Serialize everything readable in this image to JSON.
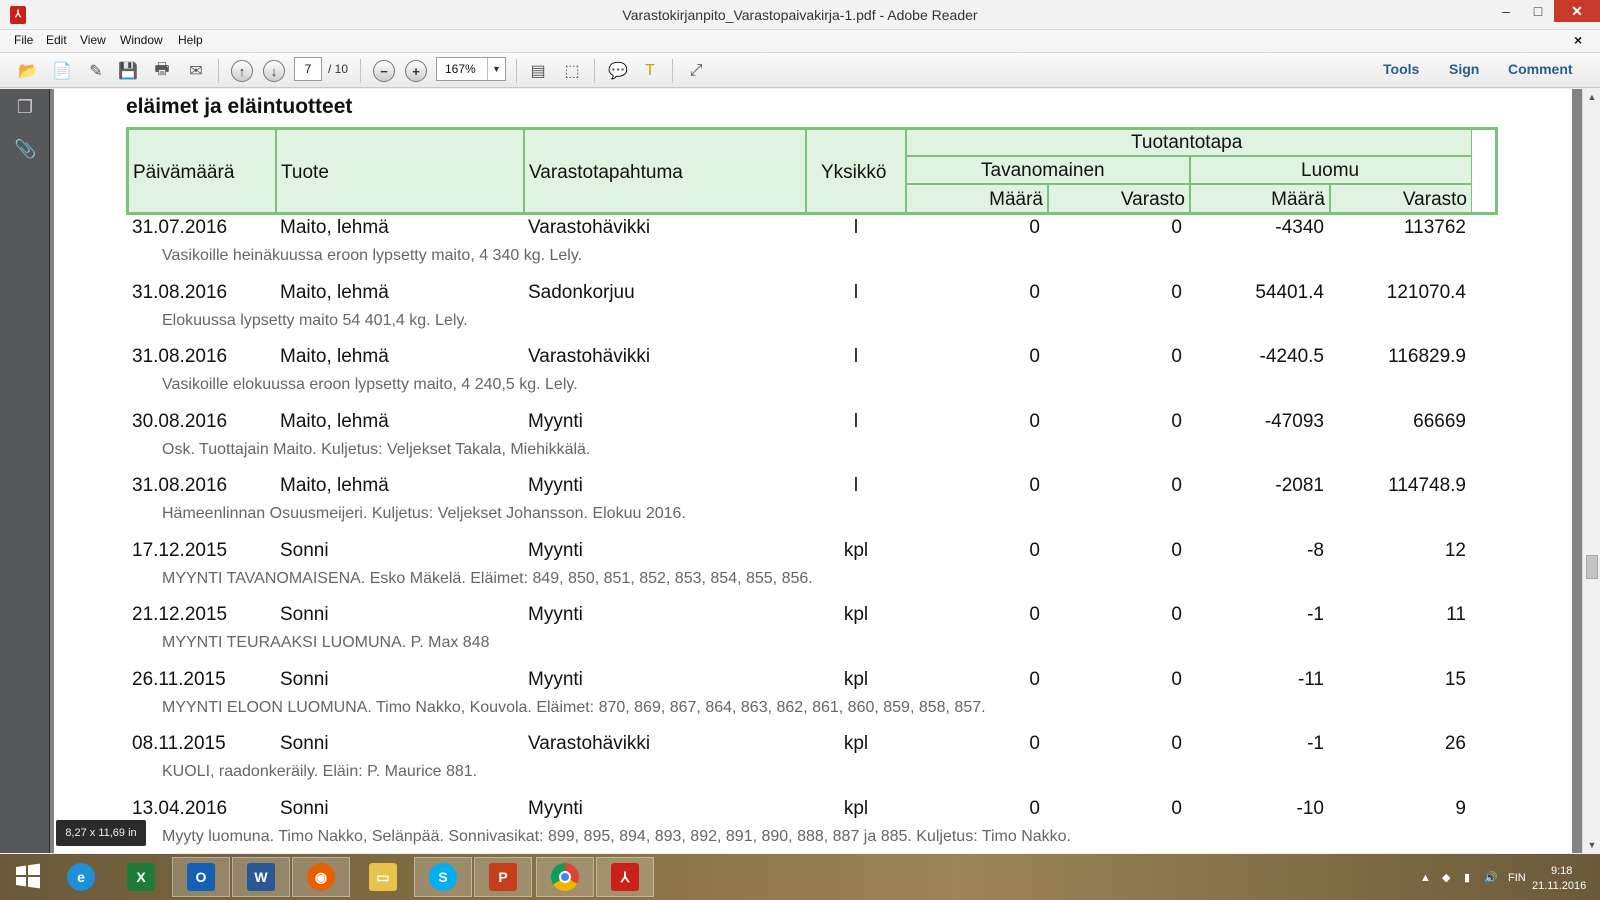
{
  "window": {
    "title": "Varastokirjanpito_Varastopaivakirja-1.pdf - Adobe Reader",
    "app_icon": "adobe-reader-icon",
    "controls": {
      "minimize": "–",
      "maximize": "□",
      "close": "✕"
    }
  },
  "menu": {
    "items": [
      "File",
      "Edit",
      "View",
      "Window",
      "Help"
    ],
    "close_doc": "×"
  },
  "toolbar": {
    "page_current": "7",
    "page_total": "/ 10",
    "zoom": "167%",
    "right_links": [
      "Tools",
      "Sign",
      "Comment"
    ]
  },
  "document": {
    "section_heading": "eläimet ja eläintuotteet",
    "table_header": {
      "date": "Päivämäärä",
      "product": "Tuote",
      "event": "Varastotapahtuma",
      "unit": "Yksikkö",
      "production_method": "Tuotantotapa",
      "conventional": "Tavanomainen",
      "organic": "Luomu",
      "conv_amount": "Määrä",
      "conv_stock": "Varasto",
      "org_amount": "Määrä",
      "org_stock": "Varasto"
    },
    "rows": [
      {
        "date": "31.07.2016",
        "product": "Maito, lehmä",
        "event": "Varastohävikki",
        "unit": "l",
        "conv_amount": "0",
        "conv_stock": "0",
        "org_amount": "-4340",
        "org_stock": "113762",
        "note": "Vasikoille heinäkuussa eroon lypsetty maito, 4 340 kg. Lely."
      },
      {
        "date": "31.08.2016",
        "product": "Maito, lehmä",
        "event": "Sadonkorjuu",
        "unit": "l",
        "conv_amount": "0",
        "conv_stock": "0",
        "org_amount": "54401.4",
        "org_stock": "121070.4",
        "note": "Elokuussa lypsetty maito 54 401,4 kg. Lely."
      },
      {
        "date": "31.08.2016",
        "product": "Maito, lehmä",
        "event": "Varastohävikki",
        "unit": "l",
        "conv_amount": "0",
        "conv_stock": "0",
        "org_amount": "-4240.5",
        "org_stock": "116829.9",
        "note": "Vasikoille elokuussa eroon lypsetty maito, 4 240,5 kg. Lely."
      },
      {
        "date": "30.08.2016",
        "product": "Maito, lehmä",
        "event": "Myynti",
        "unit": "l",
        "conv_amount": "0",
        "conv_stock": "0",
        "org_amount": "-47093",
        "org_stock": "66669",
        "note": "Osk. Tuottajain Maito. Kuljetus: Veljekset Takala, Miehikkälä."
      },
      {
        "date": "31.08.2016",
        "product": "Maito, lehmä",
        "event": "Myynti",
        "unit": "l",
        "conv_amount": "0",
        "conv_stock": "0",
        "org_amount": "-2081",
        "org_stock": "114748.9",
        "note": "Hämeenlinnan Osuusmeijeri. Kuljetus: Veljekset Johansson. Elokuu 2016."
      },
      {
        "date": "17.12.2015",
        "product": "Sonni",
        "event": "Myynti",
        "unit": "kpl",
        "conv_amount": "0",
        "conv_stock": "0",
        "org_amount": "-8",
        "org_stock": "12",
        "note": "MYYNTI TAVANOMAISENA. Esko Mäkelä. Eläimet: 849, 850, 851, 852, 853, 854, 855, 856."
      },
      {
        "date": "21.12.2015",
        "product": "Sonni",
        "event": "Myynti",
        "unit": "kpl",
        "conv_amount": "0",
        "conv_stock": "0",
        "org_amount": "-1",
        "org_stock": "11",
        "note": "MYYNTI TEURAAKSI LUOMUNA. P. Max 848"
      },
      {
        "date": "26.11.2015",
        "product": "Sonni",
        "event": "Myynti",
        "unit": "kpl",
        "conv_amount": "0",
        "conv_stock": "0",
        "org_amount": "-11",
        "org_stock": "15",
        "note": "MYYNTI ELOON LUOMUNA. Timo Nakko, Kouvola. Eläimet: 870, 869, 867, 864, 863, 862, 861, 860, 859, 858, 857."
      },
      {
        "date": "08.11.2015",
        "product": "Sonni",
        "event": "Varastohävikki",
        "unit": "kpl",
        "conv_amount": "0",
        "conv_stock": "0",
        "org_amount": "-1",
        "org_stock": "26",
        "note": "KUOLI, raadonkeräily. Eläin: P. Maurice 881."
      },
      {
        "date": "13.04.2016",
        "product": "Sonni",
        "event": "Myynti",
        "unit": "kpl",
        "conv_amount": "0",
        "conv_stock": "0",
        "org_amount": "-10",
        "org_stock": "9",
        "note": "Myyty luomuna. Timo Nakko, Selänpää. Sonnivasikat: 899, 895, 894, 893, 892, 891, 890, 888, 887 ja 885. Kuljetus: Timo Nakko."
      }
    ]
  },
  "statusbar": {
    "page_size": "8,27 x 11,69 in"
  },
  "taskbar": {
    "apps": [
      "internet-explorer-icon",
      "excel-icon",
      "outlook-icon",
      "word-icon",
      "firefox-icon",
      "file-explorer-icon",
      "skype-icon",
      "powerpoint-icon",
      "chrome-icon",
      "adobe-reader-icon"
    ],
    "tray": {
      "language": "FIN",
      "time": "9:18",
      "date": "21.11.2016"
    }
  }
}
